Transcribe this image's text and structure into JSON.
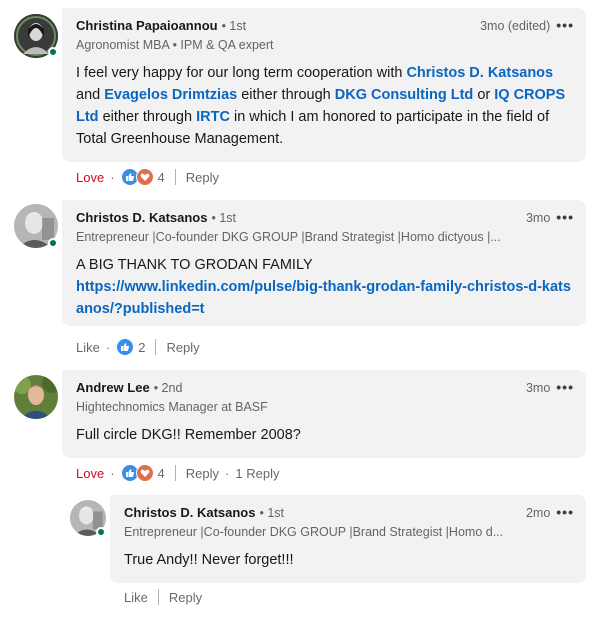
{
  "comments": [
    {
      "name": "Christina Papaioannou",
      "degree": "• 1st",
      "headline": "Agronomist MBA • IPM & QA expert",
      "time": "3mo (edited)",
      "body_parts": [
        "I feel very happy for our long term cooperation with ",
        "Christos D. Katsanos",
        " and ",
        "Evagelos Drimtzias",
        " either through ",
        "DKG Consulting Ltd",
        " or ",
        "IQ CROPS Ltd",
        " either through ",
        "IRTC",
        " in which I am honored to participate in the field of Total Greenhouse Management."
      ],
      "reaction_label": "Love",
      "reaction_count": "4",
      "reply_label": "Reply"
    },
    {
      "name": "Christos D. Katsanos",
      "degree": "• 1st",
      "headline": "Entrepreneur |Co-founder DKG GROUP |Brand Strategist |Homo dictyous |...",
      "time": "3mo",
      "body_text": "A BIG THANK TO GRODAN FAMILY",
      "body_link": "https://www.linkedin.com/pulse/big-thank-grodan-family-christos-d-katsanos/?published=t",
      "reaction_label": "Like",
      "reaction_count": "2",
      "reply_label": "Reply"
    },
    {
      "name": "Andrew Lee",
      "degree": "• 2nd",
      "headline": "Hightechnomics Manager at BASF",
      "time": "3mo",
      "body_text": "Full circle DKG!! Remember 2008?",
      "reaction_label": "Love",
      "reaction_count": "4",
      "reply_label": "Reply",
      "replies_label": "1 Reply"
    }
  ],
  "reply": {
    "name": "Christos D. Katsanos",
    "degree": "• 1st",
    "headline": "Entrepreneur |Co-founder DKG GROUP |Brand Strategist |Homo d...",
    "time": "2mo",
    "body_text": "True Andy!! Never forget!!!",
    "reaction_label": "Like",
    "reply_label": "Reply"
  },
  "ui": {
    "more_glyph": "•••",
    "dot": "·"
  },
  "colors": {
    "bubble_bg": "#f2f2f2",
    "link": "#0a66c2",
    "love": "#cb112d",
    "like_icon": "#378fe9",
    "love_icon": "#df704d",
    "online": "#057642"
  }
}
